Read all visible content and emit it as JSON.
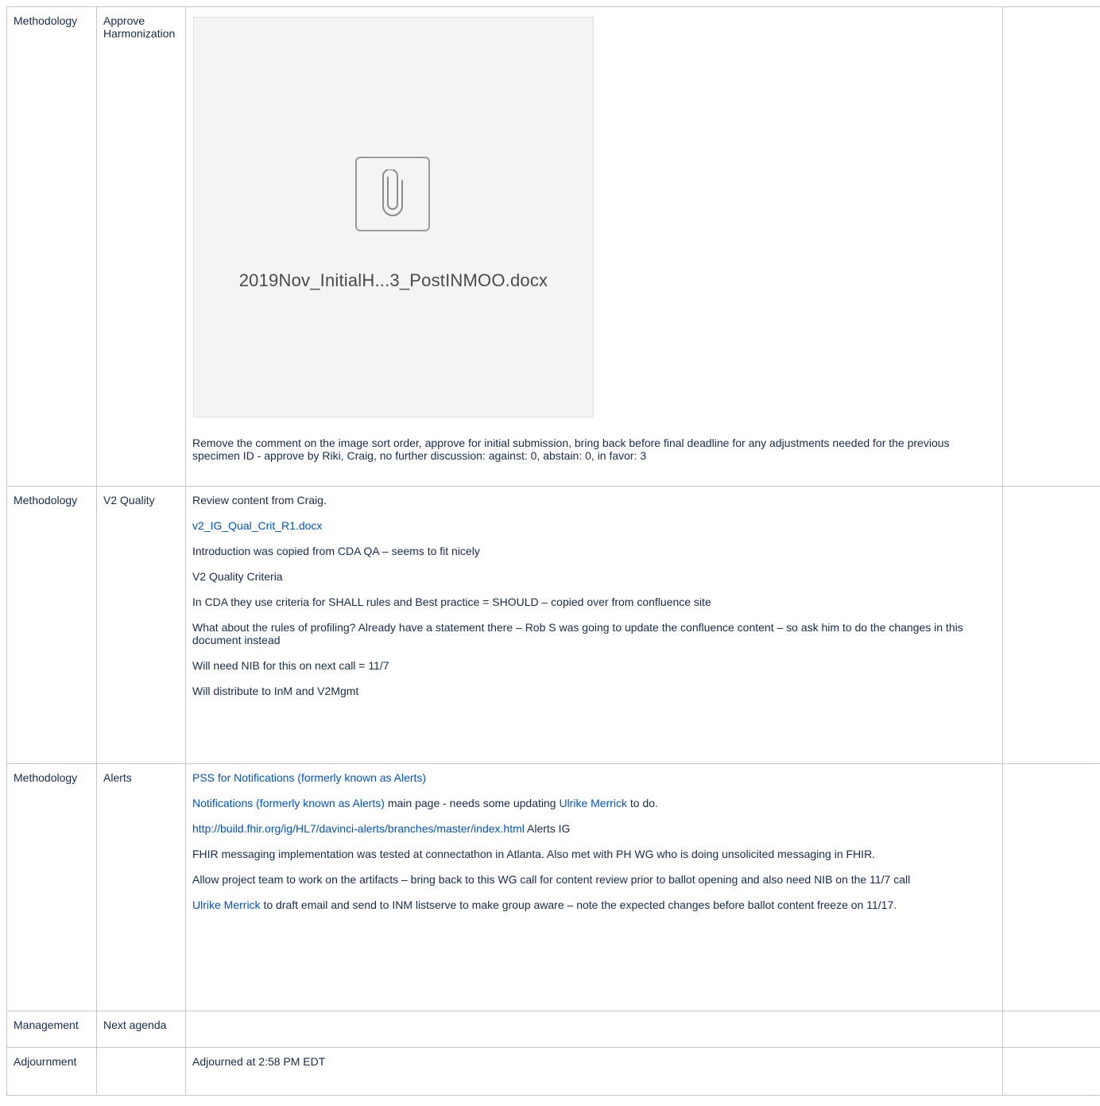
{
  "rows": [
    {
      "category": "Methodology",
      "topic": "Approve Harmonization",
      "attachment": {
        "filename": "2019Nov_InitialH...3_PostINMOO.docx",
        "icon": "paperclip-icon"
      },
      "notes": "Remove the comment on the image sort order, approve for initial submission, bring back before final deadline for any adjustments needed for the previous specimen ID - approve by Riki, Craig, no further discussion: against: 0, abstain: 0, in favor: 3"
    },
    {
      "category": "Methodology",
      "topic": "V2 Quality",
      "p1": "Review content from Craig.",
      "link1": "v2_IG_Qual_Crit_R1.docx",
      "p2": "Introduction was copied from CDA QA – seems to fit nicely",
      "p3": "V2 Quality Criteria",
      "p4": "In CDA they use criteria for SHALL rules and Best practice = SHOULD – copied over from confluence site",
      "p5": "What about the rules of profiling? Already have a statement there – Rob S was going to update the confluence content – so ask him to do the changes in this document instead",
      "p6": "Will need NIB for this on next call = 11/7",
      "p7": "Will distribute to InM and V2Mgmt"
    },
    {
      "category": "Methodology",
      "topic": "Alerts",
      "link_pss": "PSS for Notifications (formerly known as Alerts)",
      "link_main": "Notifications (formerly known as Alerts)",
      "text_main": " main page - needs some updating ",
      "mention1": "Ulrike Merrick",
      "text_todo": " to do.",
      "link_url": "http://build.fhir.org/ig/HL7/davinci-alerts/branches/master/index.html",
      "text_ig": " Alerts IG",
      "p_fhir": "FHIR messaging implementation was tested at connectathon in Atlanta.  Also met with PH WG who is doing unsolicited messaging in FHIR.",
      "p_allow": "Allow project team to work on the artifacts – bring back to this WG call for content review prior to ballot opening and also need NIB on the 11/7 call",
      "mention2": "Ulrike Merrick",
      "text_email": "  to draft email and send to INM listserve to make group aware – note the expected changes before ballot content freeze on 11/17."
    },
    {
      "category": "Management",
      "topic": " Next agenda",
      "notes": ""
    },
    {
      "category": " Adjournment",
      "topic": "",
      "notes": " Adjourned at 2:58 PM EDT"
    }
  ]
}
